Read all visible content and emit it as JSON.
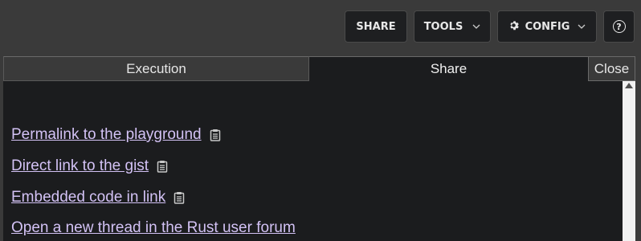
{
  "toolbar": {
    "share_label": "SHARE",
    "tools_label": "TOOLS",
    "config_label": "CONFIG",
    "help_label": "?"
  },
  "tabs": {
    "execution": "Execution",
    "share": "Share",
    "close": "Close"
  },
  "links": [
    {
      "label": "Permalink to the playground",
      "has_copy": true
    },
    {
      "label": "Direct link to the gist",
      "has_copy": true
    },
    {
      "label": "Embedded code in link",
      "has_copy": true
    },
    {
      "label": "Open a new thread in the Rust user forum",
      "has_copy": false
    }
  ],
  "colors": {
    "link": "#d3c2f5",
    "panel_bg": "#1b1c1e",
    "page_bg": "#3a3a3a"
  }
}
